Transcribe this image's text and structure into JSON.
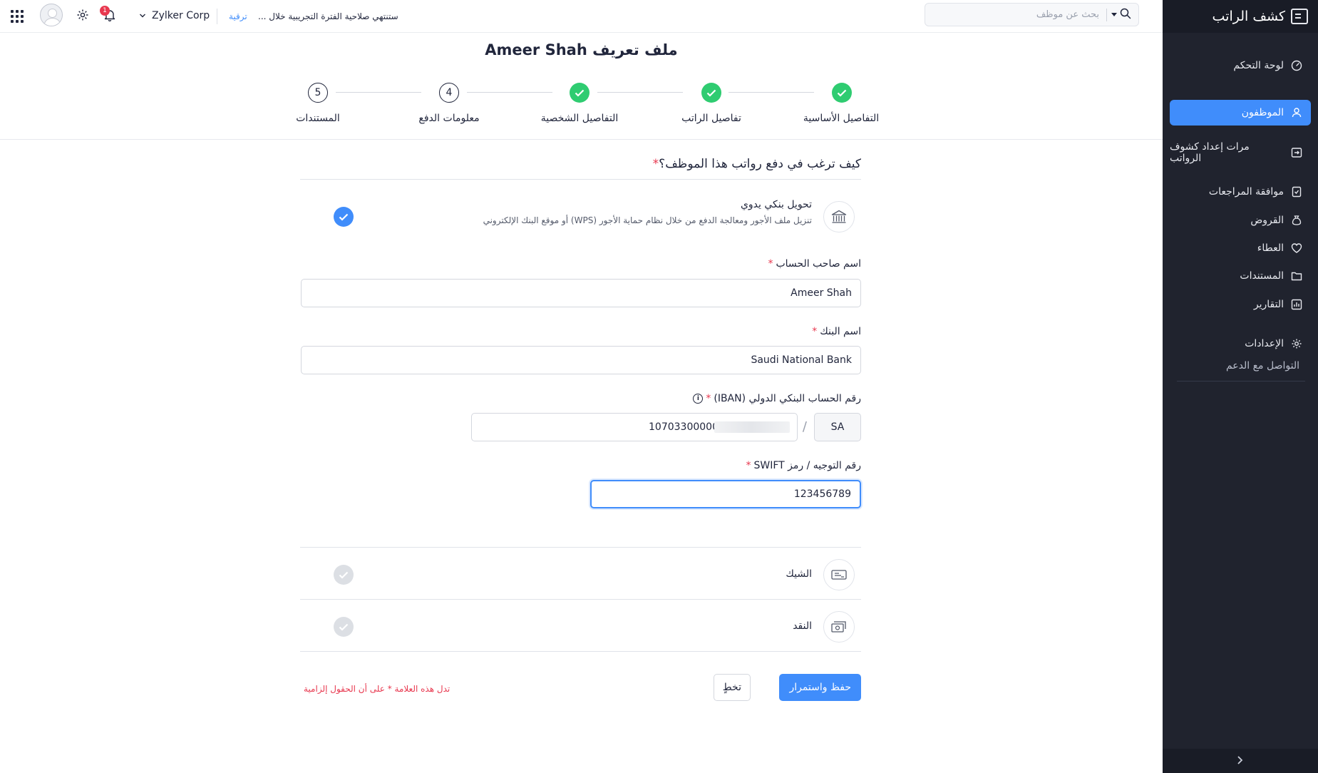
{
  "app": {
    "title": "كشف الراتب"
  },
  "sidebar": {
    "items": [
      {
        "label": "لوحة التحكم",
        "icon": "dashboard-icon"
      },
      {
        "label": "الموظفون",
        "icon": "user-icon",
        "active": true
      },
      {
        "label": "مرات إعداد كشوف الرواتب",
        "icon": "pay-runs-icon"
      },
      {
        "label": "موافقة المراجعات",
        "icon": "approvals-icon"
      },
      {
        "label": "القروض",
        "icon": "loans-icon"
      },
      {
        "label": "العطاء",
        "icon": "heart-icon"
      },
      {
        "label": "المستندات",
        "icon": "folder-icon"
      },
      {
        "label": "التقارير",
        "icon": "reports-icon"
      },
      {
        "label": "الإعدادات",
        "icon": "gear-icon"
      }
    ],
    "support_label": "التواصل مع الدعم",
    "collapse_icon": "chevron-right-icon"
  },
  "topbar": {
    "search_placeholder": "بحث عن موظف",
    "trial_text": "ستنتهي صلاحية الفترة التجريبية خلال ...",
    "upgrade_label": "ترقية",
    "org_name": "Zylker Corp",
    "notification_count": "1"
  },
  "page": {
    "title": "ملف تعريف Ameer Shah",
    "steps": [
      {
        "label": "التفاصيل الأساسية",
        "status": "done"
      },
      {
        "label": "تفاصيل الراتب",
        "status": "done"
      },
      {
        "label": "التفاصيل الشخصية",
        "status": "done"
      },
      {
        "label": "معلومات الدفع",
        "number": "4",
        "status": "current"
      },
      {
        "label": "المستندات",
        "number": "5",
        "status": "todo"
      }
    ]
  },
  "form": {
    "question": "كيف ترغب في دفع رواتب هذا الموظف؟",
    "required_mark": "*",
    "methods": [
      {
        "title": "تحويل بنكي يدوي",
        "description": "تنزيل ملف الأجور ومعالجة الدفع من خلال نظام حماية الأجور (WPS) أو موقع البنك الإلكتروني",
        "icon": "bank-icon",
        "selected": true
      },
      {
        "title": "الشيك",
        "icon": "cheque-icon",
        "selected": false
      },
      {
        "title": "النقد",
        "icon": "cash-icon",
        "selected": false
      }
    ],
    "fields": {
      "account_holder": {
        "label": "اسم صاحب الحساب",
        "value": "Ameer Shah"
      },
      "bank_name": {
        "label": "اسم البنك",
        "value": "Saudi National Bank"
      },
      "iban": {
        "label": "رقم الحساب البنكي الدولي (IBAN)",
        "prefix": "SA",
        "separator": "/",
        "value": "10703300000"
      },
      "swift": {
        "label": "رقم التوجيه / رمز SWIFT",
        "value": "123456789"
      }
    },
    "buttons": {
      "save": "حفظ واستمرار",
      "skip": "تخطٍ"
    },
    "required_note": "تدل هذه العلامة * على أن الحقول إلزامية"
  },
  "colors": {
    "accent": "#408dfb",
    "success": "#2fcc71",
    "danger": "#e8384f",
    "sidebar_bg": "#20232e"
  }
}
